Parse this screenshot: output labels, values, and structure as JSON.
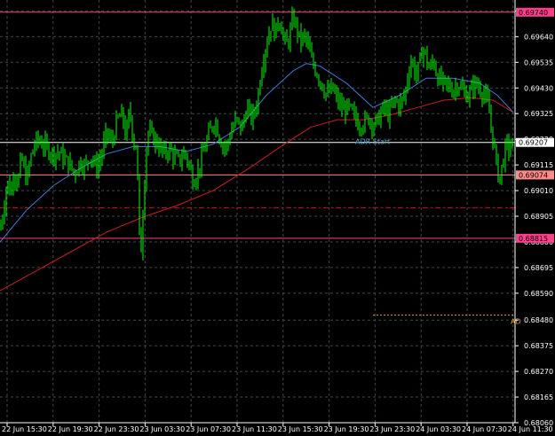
{
  "chart_data": {
    "type": "candlestick",
    "instrument_note": "",
    "y_range": [
      0.6806,
      0.6979
    ],
    "y_ticks": [
      "0.69745",
      "0.69640",
      "0.69535",
      "0.69430",
      "0.69325",
      "0.69220",
      "0.69115",
      "0.69010",
      "0.68905",
      "0.68800",
      "0.68695",
      "0.68590",
      "0.68480",
      "0.68375",
      "0.68270",
      "0.68165",
      "0.68060"
    ],
    "x_ticks": [
      "22 Jun 15:30",
      "22 Jun 19:30",
      "22 Jun 23:30",
      "23 Jun 03:30",
      "23 Jun 07:30",
      "23 Jun 11:30",
      "23 Jun 15:30",
      "23 Jun 19:30",
      "23 Jun 23:30",
      "24 Jun 03:30",
      "24 Jun 07:30",
      "24 Jun 11:30"
    ],
    "price_path": [
      [
        0,
        0.6885
      ],
      [
        4,
        0.6893
      ],
      [
        8,
        0.6905
      ],
      [
        12,
        0.69
      ],
      [
        16,
        0.691
      ],
      [
        20,
        0.6903
      ],
      [
        24,
        0.6915
      ],
      [
        30,
        0.6905
      ],
      [
        36,
        0.6917
      ],
      [
        42,
        0.6922
      ],
      [
        48,
        0.692
      ],
      [
        54,
        0.6918
      ],
      [
        60,
        0.6916
      ],
      [
        66,
        0.6917
      ],
      [
        72,
        0.6914
      ],
      [
        78,
        0.6912
      ],
      [
        84,
        0.6908
      ],
      [
        90,
        0.6913
      ],
      [
        96,
        0.6911
      ],
      [
        102,
        0.6916
      ],
      [
        108,
        0.691
      ],
      [
        114,
        0.6915
      ],
      [
        120,
        0.6925
      ],
      [
        126,
        0.692
      ],
      [
        132,
        0.693
      ],
      [
        138,
        0.6932
      ],
      [
        142,
        0.6922
      ],
      [
        146,
        0.6935
      ],
      [
        150,
        0.6922
      ],
      [
        154,
        0.6918
      ],
      [
        158,
        0.687
      ],
      [
        162,
        0.69
      ],
      [
        166,
        0.6925
      ],
      [
        172,
        0.6923
      ],
      [
        178,
        0.692
      ],
      [
        184,
        0.6916
      ],
      [
        190,
        0.6918
      ],
      [
        196,
        0.6915
      ],
      [
        202,
        0.6913
      ],
      [
        208,
        0.6917
      ],
      [
        214,
        0.691
      ],
      [
        218,
        0.6905
      ],
      [
        224,
        0.691
      ],
      [
        230,
        0.6918
      ],
      [
        236,
        0.6925
      ],
      [
        242,
        0.693
      ],
      [
        248,
        0.6922
      ],
      [
        254,
        0.6918
      ],
      [
        260,
        0.6925
      ],
      [
        266,
        0.693
      ],
      [
        272,
        0.6926
      ],
      [
        278,
        0.6935
      ],
      [
        284,
        0.693
      ],
      [
        290,
        0.6938
      ],
      [
        294,
        0.695
      ],
      [
        298,
        0.6958
      ],
      [
        302,
        0.6964
      ],
      [
        306,
        0.697
      ],
      [
        310,
        0.6965
      ],
      [
        314,
        0.6972
      ],
      [
        318,
        0.6966
      ],
      [
        322,
        0.696
      ],
      [
        326,
        0.6964
      ],
      [
        330,
        0.6972
      ],
      [
        334,
        0.6968
      ],
      [
        338,
        0.6962
      ],
      [
        342,
        0.6964
      ],
      [
        346,
        0.6962
      ],
      [
        350,
        0.6955
      ],
      [
        356,
        0.695
      ],
      [
        362,
        0.6945
      ],
      [
        368,
        0.694
      ],
      [
        374,
        0.6943
      ],
      [
        380,
        0.6938
      ],
      [
        386,
        0.6934
      ],
      [
        392,
        0.6935
      ],
      [
        398,
        0.6932
      ],
      [
        404,
        0.6928
      ],
      [
        410,
        0.6929
      ],
      [
        416,
        0.6931
      ],
      [
        420,
        0.6928
      ],
      [
        426,
        0.693
      ],
      [
        432,
        0.6935
      ],
      [
        438,
        0.6932
      ],
      [
        444,
        0.6938
      ],
      [
        450,
        0.6936
      ],
      [
        456,
        0.694
      ],
      [
        460,
        0.695
      ],
      [
        464,
        0.6955
      ],
      [
        468,
        0.6948
      ],
      [
        472,
        0.6952
      ],
      [
        476,
        0.696
      ],
      [
        480,
        0.6955
      ],
      [
        484,
        0.695
      ],
      [
        488,
        0.6955
      ],
      [
        492,
        0.6948
      ],
      [
        498,
        0.6945
      ],
      [
        504,
        0.6944
      ],
      [
        510,
        0.6942
      ],
      [
        516,
        0.6945
      ],
      [
        522,
        0.6941
      ],
      [
        528,
        0.694
      ],
      [
        534,
        0.6945
      ],
      [
        540,
        0.6943
      ],
      [
        546,
        0.694
      ],
      [
        550,
        0.6935
      ],
      [
        554,
        0.6925
      ],
      [
        558,
        0.6915
      ],
      [
        562,
        0.6905
      ],
      [
        566,
        0.6912
      ],
      [
        570,
        0.692
      ],
      [
        574,
        0.6918
      ],
      [
        578,
        0.6921
      ]
    ],
    "blue_ma_path": [
      [
        0,
        0.688
      ],
      [
        30,
        0.6893
      ],
      [
        60,
        0.6903
      ],
      [
        90,
        0.691
      ],
      [
        120,
        0.6916
      ],
      [
        150,
        0.6919
      ],
      [
        180,
        0.6919
      ],
      [
        210,
        0.6917
      ],
      [
        240,
        0.692
      ],
      [
        270,
        0.6927
      ],
      [
        300,
        0.694
      ],
      [
        330,
        0.695
      ],
      [
        345,
        0.6953
      ],
      [
        360,
        0.6952
      ],
      [
        390,
        0.6945
      ],
      [
        420,
        0.6935
      ],
      [
        450,
        0.694
      ],
      [
        480,
        0.6947
      ],
      [
        510,
        0.6947
      ],
      [
        540,
        0.6945
      ],
      [
        560,
        0.694
      ],
      [
        578,
        0.6933
      ]
    ],
    "red_ma_path": [
      [
        0,
        0.686
      ],
      [
        40,
        0.6868
      ],
      [
        80,
        0.6876
      ],
      [
        120,
        0.6884
      ],
      [
        160,
        0.689
      ],
      [
        200,
        0.6895
      ],
      [
        240,
        0.6901
      ],
      [
        280,
        0.691
      ],
      [
        320,
        0.692
      ],
      [
        350,
        0.6927
      ],
      [
        380,
        0.693
      ],
      [
        410,
        0.693
      ],
      [
        440,
        0.6932
      ],
      [
        470,
        0.6935
      ],
      [
        500,
        0.6938
      ],
      [
        530,
        0.6939
      ],
      [
        555,
        0.6938
      ],
      [
        578,
        0.6933
      ]
    ],
    "horizontal_levels": [
      {
        "price": 0.6974,
        "label": "0.69740",
        "color": "#ff3d8b",
        "style": "solid"
      },
      {
        "price": 0.69207,
        "label": "0.69207",
        "color": "#ffffff",
        "style": "solid"
      },
      {
        "price": 0.69074,
        "label": "0.69074",
        "color": "#ff8a8a",
        "style": "solid"
      },
      {
        "price": 0.68815,
        "label": "0.68815",
        "color": "#ff3d8b",
        "style": "solid"
      },
      {
        "price": 0.6894,
        "label": "",
        "color": "#d01010",
        "style": "dashdot"
      }
    ],
    "adr_start": {
      "text": "ADR Start",
      "price": 0.69215,
      "color": "#4aa0c8"
    },
    "adr_line": {
      "text": "AD",
      "price": 0.685,
      "color": "#e8a020",
      "x_from": 420
    },
    "colors": {
      "background": "#000000",
      "grid": "#3c4a4a",
      "candle": "#00ff00",
      "blue_ma": "#3a7bd5",
      "red_ma": "#d01a1a",
      "axis": "#ffffff"
    }
  }
}
